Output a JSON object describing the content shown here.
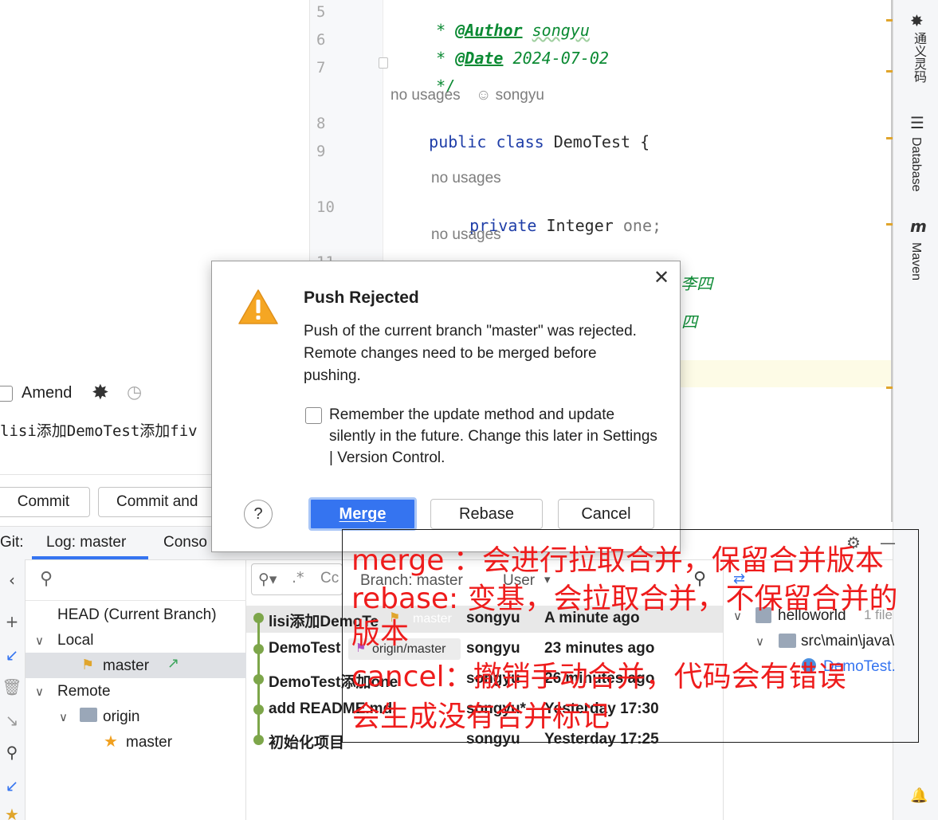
{
  "editor": {
    "lines": [
      {
        "num": "5",
        "code": " * @Author songyu"
      },
      {
        "num": "6",
        "code": " * @Date 2024-07-02"
      },
      {
        "num": "7",
        "code": " */"
      },
      {
        "num": "8",
        "code": "public class DemoTest {"
      },
      {
        "num": "9",
        "code": ""
      },
      {
        "num": "10",
        "code": "private Integer one;"
      },
      {
        "num": "11",
        "code": "private Integer two;//李四"
      }
    ],
    "author_tag": "@Author",
    "author_name": "songyu",
    "date_tag": "@Date",
    "date_value": "2024-07-02",
    "doc_close": "*/",
    "doc_star": "*",
    "class_kw": "public class",
    "class_name": "DemoTest {",
    "private_kw": "private",
    "type_name": "Integer",
    "field_one": "one;",
    "field_two_partial": "two;//李四",
    "trailing_partial": "四",
    "usage_hint_class": "no usages",
    "author_hint": "songyu",
    "usage_hint_1": "no usages",
    "usage_hint_2": "no usages"
  },
  "right_tools": {
    "tongyi": "通义灵码",
    "database": "Database",
    "maven": "Maven",
    "maven_icon": "m"
  },
  "commit": {
    "amend_label": "Amend",
    "message": "lisi添加DemoTest添加fiv",
    "commit_button": "Commit",
    "commit_push_button": "Commit and"
  },
  "git": {
    "tabs": [
      {
        "label": "Git:"
      },
      {
        "label": "Log: master"
      },
      {
        "label": "Conso"
      }
    ],
    "tree": {
      "head": "HEAD (Current Branch)",
      "local": "Local",
      "local_master": "master",
      "remote": "Remote",
      "origin": "origin",
      "origin_master": "master"
    },
    "filters": {
      "branch": "Branch: master",
      "user": "User"
    },
    "log_rows": [
      {
        "message": "lisi添加DemoTe",
        "tag": "master",
        "author": "songyu",
        "date": "A minute ago"
      },
      {
        "message": "DemoTest",
        "tag": "origin/master",
        "author": "songyu",
        "date": "23 minutes ago"
      },
      {
        "message": "DemoTest添加one",
        "tag": "",
        "author": "songyu",
        "date": "26 minutes ago"
      },
      {
        "message": "add README.md.",
        "tag": "",
        "author": "songyu*",
        "date": "Yesterday 17:30"
      },
      {
        "message": "初始化项目",
        "tag": "",
        "author": "songyu",
        "date": "Yesterday 17:25"
      }
    ],
    "changes": {
      "root": "helloworld",
      "root_count": "1 file",
      "path": "src\\main\\java\\",
      "file": "DemoTest."
    }
  },
  "dialog": {
    "title": "Push Rejected",
    "message": "Push of the current branch \"master\" was rejected. Remote changes need to be merged before pushing.",
    "remember_label": "Remember the update method and update silently in the future. Change this later in Settings | Version Control.",
    "help": "?",
    "merge_button": "Merge",
    "rebase_button": "Rebase",
    "cancel_button": "Cancel"
  },
  "annotation": {
    "line1": "merge ：会进行拉取合并，保留合并版本",
    "line2": "rebase: 变基，会拉取合并，不保留合并的",
    "line3": "版本",
    "line4": "cancel：撤销手动合并，代码会有错误",
    "line5": "会生成没有合并标记"
  },
  "colors": {
    "accent": "#3574f0",
    "annotation_red": "#ee1c1c",
    "doc_green": "#0b8a33",
    "keyword_blue": "#1f3ea8",
    "graph_green": "#7da64a",
    "warning_orange": "#f5a623"
  }
}
